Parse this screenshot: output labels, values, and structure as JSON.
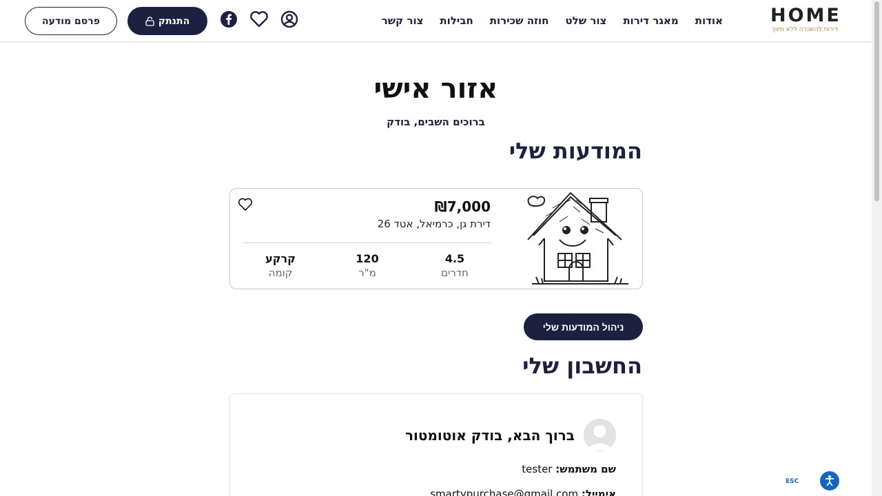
{
  "header": {
    "logo_text": "HOME",
    "logo_tagline": "דירות להשכרה ללא תיווך",
    "nav": [
      "אודות",
      "מאגר דירות",
      "צור שלט",
      "חוזה שכירות",
      "חבילות",
      "צור קשר"
    ],
    "logout_label": "התנתק",
    "publish_label": "פרסם מודעה"
  },
  "page": {
    "title": "אזור אישי",
    "greeting": "ברוכים השבים, בודק",
    "ads_heading": "המודעות שלי",
    "account_heading": "החשבון שלי",
    "manage_button": "ניהול המודעות שלי"
  },
  "listing": {
    "price": "₪7,000",
    "address": "דירת גן, כרמיאל, אטד 26",
    "rooms_value": "4.5",
    "rooms_label": "חדרים",
    "size_value": "120",
    "size_label": "מ\"ר",
    "floor_value": "קרקע",
    "floor_label": "קומה"
  },
  "account": {
    "welcome": "ברוך הבא, בודק אוטומטור",
    "username_label": "שם משתמש:",
    "username": "tester",
    "email_label": "אימייל:",
    "email": "smartypurchase@gmail.com"
  },
  "accessibility": {
    "esc_label": "ESC"
  },
  "colors": {
    "brand_dark": "#1c2140",
    "accent_gold": "#b58a56",
    "a11y_blue": "#1565c0"
  }
}
